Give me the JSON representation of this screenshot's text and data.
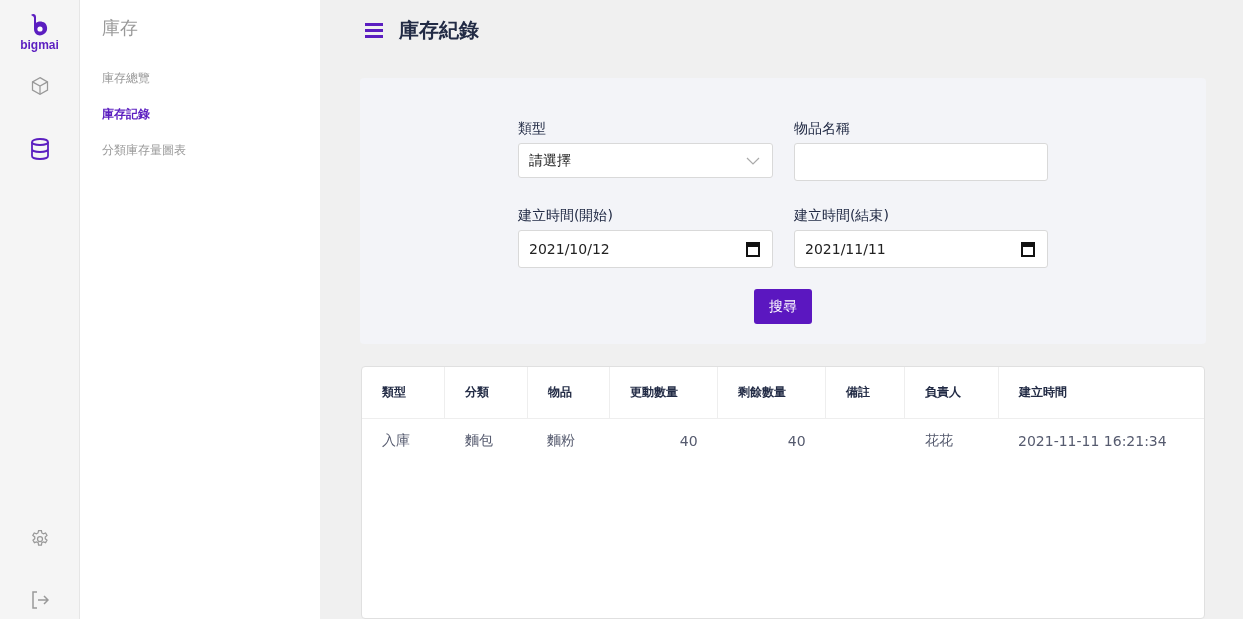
{
  "logo": {
    "text": "bigmai"
  },
  "rail": [
    {
      "kind": "box",
      "selected": false
    },
    {
      "kind": "database",
      "selected": true
    }
  ],
  "rail_bottom": [
    {
      "kind": "settings"
    },
    {
      "kind": "logout"
    }
  ],
  "submenu": {
    "title": "庫存",
    "items": [
      {
        "label": "庫存總覽",
        "selected": false
      },
      {
        "label": "庫存記錄",
        "selected": true
      },
      {
        "label": "分類庫存量圖表",
        "selected": false
      }
    ]
  },
  "page_title": "庫存紀錄",
  "filters": [
    {
      "kind": "select",
      "label": "類型",
      "value": "請選擇"
    },
    {
      "kind": "text",
      "label": "物品名稱"
    },
    {
      "kind": "date",
      "label": "建立時間(開始)",
      "value": "2021/10/12"
    },
    {
      "kind": "date",
      "label": "建立時間(結束)",
      "value": "2021/11/11"
    }
  ],
  "search_button": "搜尋",
  "table": {
    "columns": [
      "類型",
      "分類",
      "物品",
      "更動數量",
      "剩餘數量",
      "備註",
      "負責人",
      "建立時間"
    ],
    "rows": [
      [
        "入庫",
        "麵包",
        "麵粉",
        "40",
        "40",
        "",
        "花花",
        "2021-11-11 16:21:34"
      ]
    ]
  }
}
